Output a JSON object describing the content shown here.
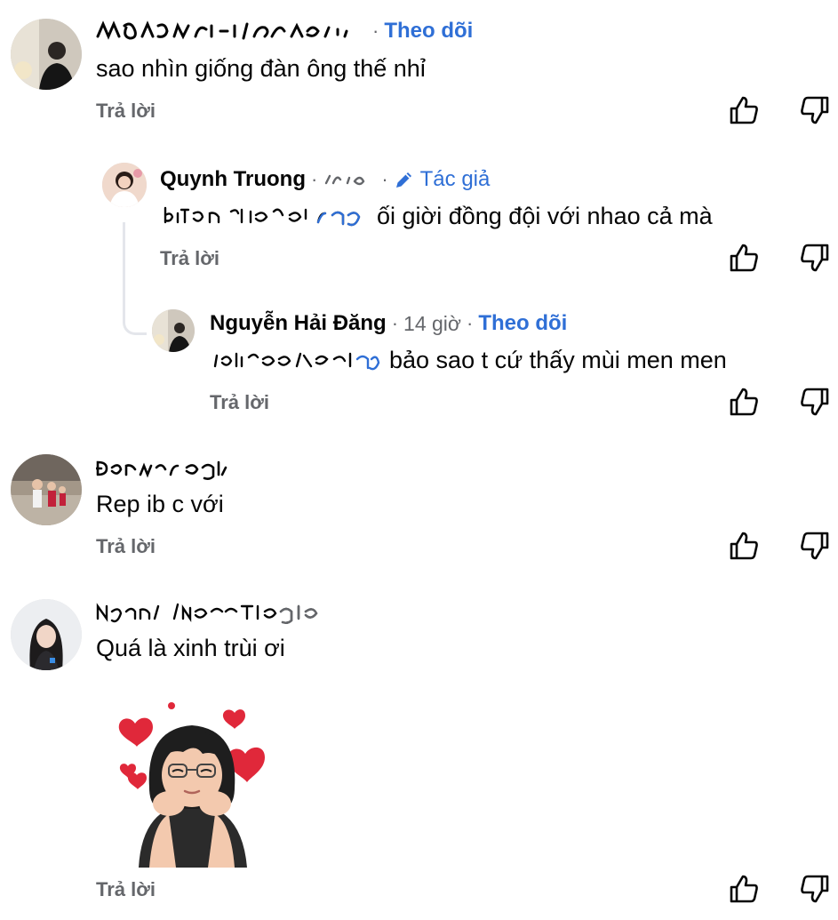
{
  "comments": [
    {
      "name": "",
      "follow_label": "Theo dõi",
      "text": "sao nhìn giống đàn ông thế nhỉ",
      "reply_label": "Trả lời",
      "like_icon": "thumbs-up-icon",
      "dislike_icon": "thumbs-down-icon"
    },
    {
      "name": "Quynh Truong",
      "author_badge": "Tác giả",
      "author_icon": "pencil-icon",
      "text": "ối giời đồng đội với nhao cả mà",
      "reply_label": "Trả lời"
    },
    {
      "name": "Nguyễn Hải Đăng",
      "time": "14 giờ",
      "follow_label": "Theo dõi",
      "text": "bảo sao t cứ thấy mùi men men",
      "reply_label": "Trả lời"
    },
    {
      "name": "",
      "text": "Rep ib c với",
      "reply_label": "Trả lời"
    },
    {
      "name": "",
      "text": "Quá là xinh trùi ơi",
      "reply_label": "Trả lời",
      "sticker": "heart-eyes-sticker"
    }
  ],
  "colors": {
    "link_blue": "#2f6fd6",
    "meta_gray": "#65676b",
    "text": "#050505",
    "thread_line": "#e4e6eb",
    "heart_red": "#e0283a"
  }
}
